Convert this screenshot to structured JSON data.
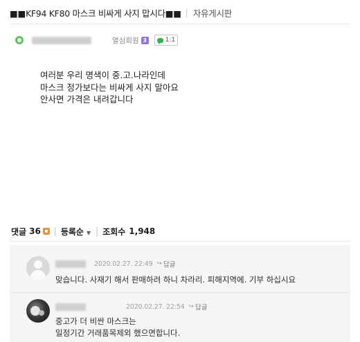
{
  "post": {
    "title": "■■KF94 KF80 마스크 비싸게 사지 맙시다■■",
    "board": "자유게시판",
    "author": {
      "grade": "열심회원",
      "grade_badge": "3",
      "chat_label": "1:1"
    },
    "body_lines": [
      "여러분 우리 명색이 중.고.나라인데",
      "마스크 정가보다는 비싸게 사지 말아요",
      "안사면 가격은 내려갑니다"
    ]
  },
  "stats": {
    "comments_label": "댓글",
    "comments_count": "36",
    "sort_label": "등록순",
    "views_label": "조회수",
    "views_count": "1,948"
  },
  "comments": [
    {
      "date": "2020.02.27. 22:49",
      "reply_label": "답글",
      "lines": [
        "맞습니다. 사재기 해서 판매하려 하니 차라리. 피해지역에. 기부 하십시요"
      ]
    },
    {
      "date": "2020.02.27. 22:54",
      "reply_label": "답글",
      "lines": [
        "중고가 더 비싼 마스크는",
        "일정기간 거래품목제외 했으면합니다."
      ]
    }
  ],
  "colors": {
    "status_dot": "#5cc45c",
    "grade_badge": "#9673d8",
    "chat_icon": "#31b24b",
    "new_badge": "#ee8f3c",
    "comments_bg": "#f5f5f5"
  },
  "icons": [
    "online-status-icon",
    "member-grade-badge-icon",
    "chat-icon",
    "new-comment-icon",
    "sort-arrow-icon",
    "reply-arrow-icon",
    "default-avatar-icon"
  ]
}
